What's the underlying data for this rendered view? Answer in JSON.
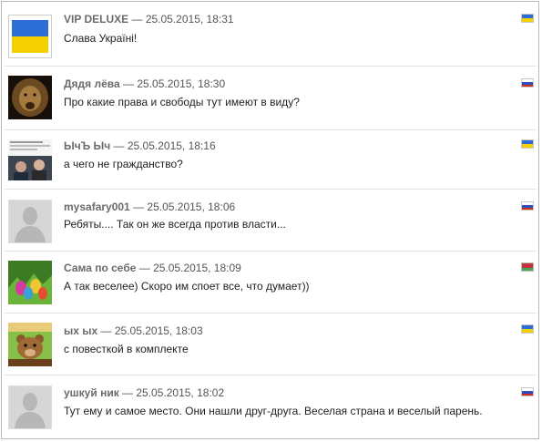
{
  "comments": [
    {
      "author": "VIP DELUXE",
      "sep": " — ",
      "datetime": "25.05.2015, 18:31",
      "text": "Слава Україні!",
      "flag": "ua",
      "avatar": "ua-flag-avatar"
    },
    {
      "author": "Дядя лёва",
      "sep": " — ",
      "datetime": "25.05.2015, 18:30",
      "text": "Про какие права и свободы тут имеют в виду?",
      "flag": "ru",
      "avatar": "lion-avatar"
    },
    {
      "author": "ЫчЪ Ыч",
      "sep": " — ",
      "datetime": "25.05.2015, 18:16",
      "text": "а чего не гражданство?",
      "flag": "ua",
      "avatar": "news-photo-avatar"
    },
    {
      "author": "mysafary001",
      "sep": " — ",
      "datetime": "25.05.2015, 18:06",
      "text": "Ребяты.... Так он же всегда против власти...",
      "flag": "ru",
      "avatar": "default-avatar"
    },
    {
      "author": "Сама по себе",
      "sep": " — ",
      "datetime": "25.05.2015, 18:09",
      "text": "А так веселее) Скоро им споет все, что думает))",
      "flag": "by",
      "avatar": "easter-eggs-avatar"
    },
    {
      "author": "ых ых",
      "sep": " — ",
      "datetime": "25.05.2015, 18:03",
      "text": "с повесткой в комплекте",
      "flag": "ua",
      "avatar": "bear-avatar"
    },
    {
      "author": "ушкуй ник",
      "sep": " — ",
      "datetime": "25.05.2015, 18:02",
      "text": "Тут ему и самое место. Они нашли друг-друга. Веселая страна и веселый парень.",
      "flag": "ru",
      "avatar": "default-avatar"
    }
  ],
  "colors": {
    "ua_blue": "#2c6ed5",
    "ua_yellow": "#f5d000",
    "ru_white": "#ffffff",
    "ru_blue": "#2b4fc4",
    "ru_red": "#d52b1e",
    "by_red": "#c8313e",
    "by_green": "#4aa657"
  }
}
